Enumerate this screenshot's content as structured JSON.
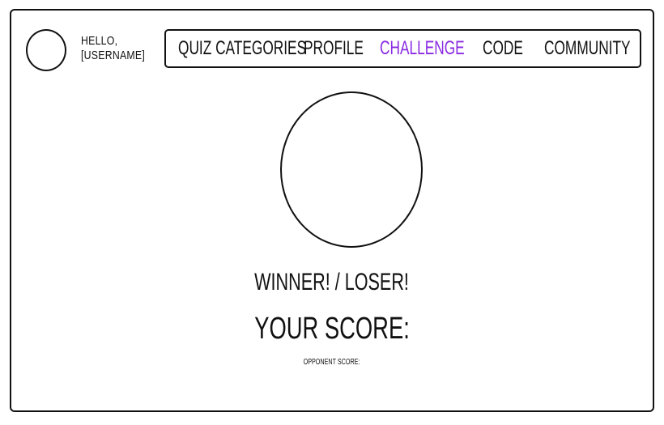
{
  "header": {
    "greeting_line1": "HELLO,",
    "greeting_line2": "[USERNAME]"
  },
  "nav": {
    "items": [
      {
        "label": "QUIZ CATEGORIES",
        "active": false
      },
      {
        "label": "PROFILE",
        "active": false
      },
      {
        "label": "CHALLENGE",
        "active": true
      },
      {
        "label": "CODE",
        "active": false
      },
      {
        "label": "COMMUNITY",
        "active": false
      }
    ]
  },
  "main": {
    "result_text": "WINNER! / LOSER!",
    "your_score_label": "YOUR SCORE:",
    "opponent_score_label": "OPPONENT SCORE:"
  },
  "colors": {
    "accent": "#8a2be2",
    "ink": "#111111",
    "background": "#ffffff"
  }
}
